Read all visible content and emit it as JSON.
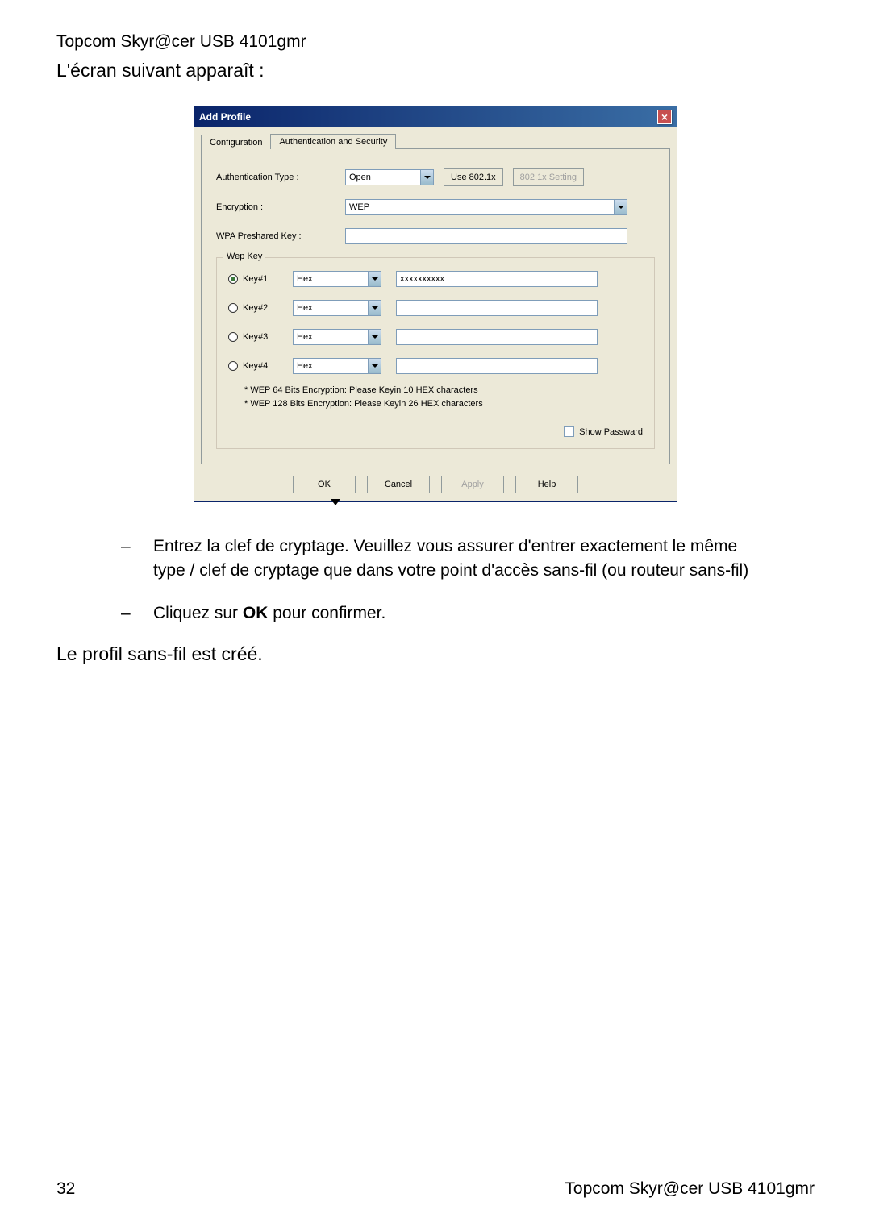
{
  "header": {
    "product": "Topcom Skyr@cer USB 4101gmr",
    "subtitle": "L'écran suivant apparaît :"
  },
  "dialog": {
    "title": "Add Profile",
    "tabs": {
      "config": "Configuration",
      "auth": "Authentication and Security"
    },
    "labels": {
      "authtype": "Authentication Type :",
      "encryption": "Encryption :",
      "wpakey": "WPA Preshared Key :",
      "wepkey_legend": "Wep Key"
    },
    "values": {
      "authtype": "Open",
      "encryption": "WEP",
      "use8021x": "Use 802.1x",
      "setting8021x": "802.1x Setting",
      "key1_label": "Key#1",
      "key2_label": "Key#2",
      "key3_label": "Key#3",
      "key4_label": "Key#4",
      "hex": "Hex",
      "key1_value": "xxxxxxxxxx"
    },
    "hint1": "* WEP 64 Bits Encryption:   Please Keyin 10 HEX characters",
    "hint2": "* WEP 128 Bits Encryption:   Please Keyin 26 HEX characters",
    "showpass": "Show Passward",
    "buttons": {
      "ok": "OK",
      "cancel": "Cancel",
      "apply": "Apply",
      "help": "Help"
    }
  },
  "instructions": {
    "line1": "Entrez la clef de cryptage. Veuillez vous assurer d'entrer exactement le même type / clef de cryptage que dans votre point d'accès sans-fil (ou routeur sans-fil)",
    "line2a": "Cliquez sur ",
    "line2b": "OK",
    "line2c": " pour confirmer."
  },
  "conclusion": "Le profil sans-fil est créé.",
  "footer": {
    "page": "32",
    "product": "Topcom Skyr@cer USB 4101gmr"
  }
}
